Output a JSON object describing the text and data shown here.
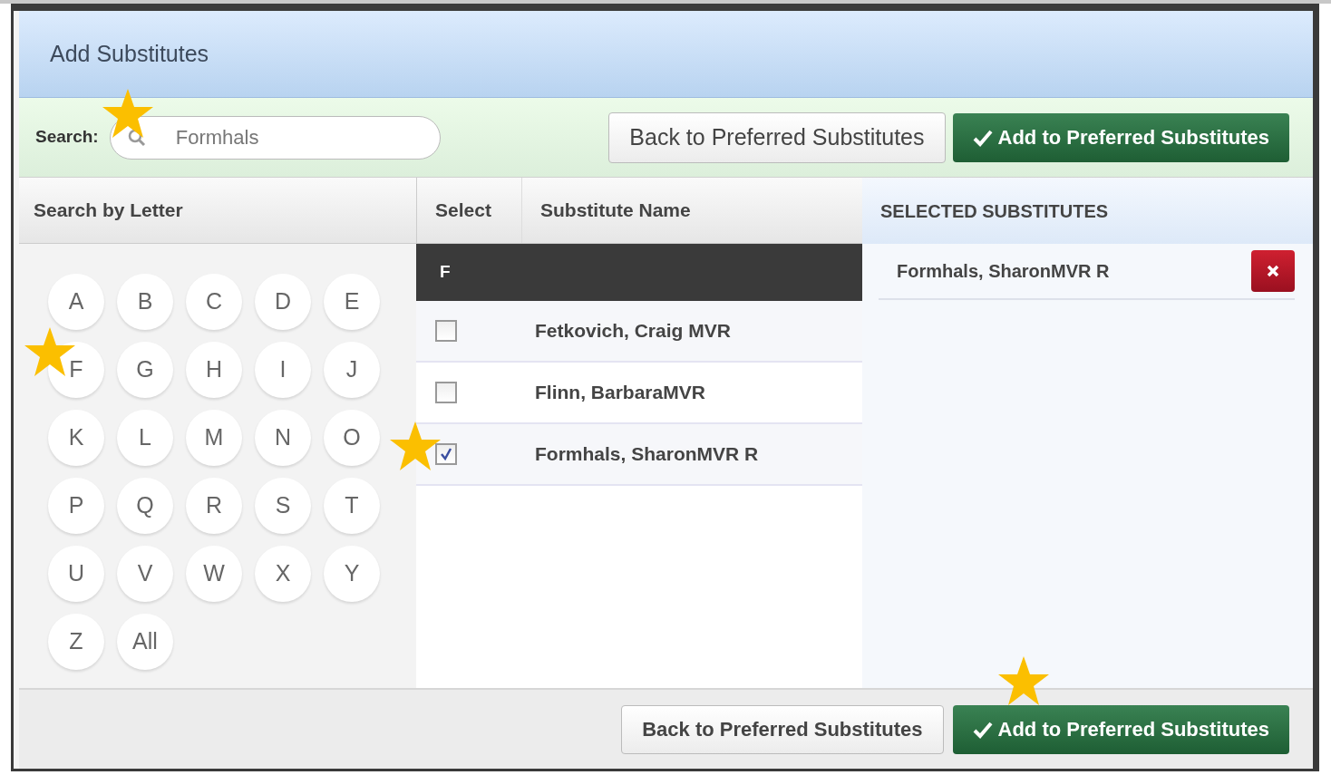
{
  "window": {
    "title": "Add Substitutes"
  },
  "toolbar": {
    "search_label": "Search:",
    "search": {
      "value": "Formhals",
      "starred": true
    },
    "back_button": "Back to Preferred Substitutes",
    "add_button": {
      "label": "Add to Preferred Substitutes"
    }
  },
  "letter_panel": {
    "heading": "Search by Letter",
    "letters": [
      {
        "label": "A",
        "starred": false
      },
      {
        "label": "B",
        "starred": false
      },
      {
        "label": "C",
        "starred": false
      },
      {
        "label": "D",
        "starred": false
      },
      {
        "label": "E",
        "starred": false
      },
      {
        "label": "F",
        "starred": true
      },
      {
        "label": "G",
        "starred": false
      },
      {
        "label": "H",
        "starred": false
      },
      {
        "label": "I",
        "starred": false
      },
      {
        "label": "J",
        "starred": false
      },
      {
        "label": "K",
        "starred": false
      },
      {
        "label": "L",
        "starred": false
      },
      {
        "label": "M",
        "starred": false
      },
      {
        "label": "N",
        "starred": false
      },
      {
        "label": "O",
        "starred": false
      },
      {
        "label": "P",
        "starred": false
      },
      {
        "label": "Q",
        "starred": false
      },
      {
        "label": "R",
        "starred": false
      },
      {
        "label": "S",
        "starred": false
      },
      {
        "label": "T",
        "starred": false
      },
      {
        "label": "U",
        "starred": false
      },
      {
        "label": "V",
        "starred": false
      },
      {
        "label": "W",
        "starred": false
      },
      {
        "label": "X",
        "starred": false
      },
      {
        "label": "Y",
        "starred": false
      },
      {
        "label": "Z",
        "starred": false
      },
      {
        "label": "All",
        "starred": false
      }
    ]
  },
  "table": {
    "columns": [
      "Select",
      "Substitute Name"
    ],
    "group": "F",
    "rows": [
      {
        "name": "Fetkovich, Craig MVR",
        "checked": false,
        "starred": false
      },
      {
        "name": "Flinn, BarbaraMVR",
        "checked": false,
        "starred": false
      },
      {
        "name": "Formhals, SharonMVR R",
        "checked": true,
        "starred": true
      }
    ]
  },
  "selected_panel": {
    "heading": "SELECTED SUBSTITUTES",
    "items": [
      "Formhals, SharonMVR R"
    ]
  },
  "footer": {
    "back_button": "Back to Preferred Substitutes",
    "add_button": {
      "label": "Add to Preferred Substitutes",
      "starred": true
    }
  }
}
